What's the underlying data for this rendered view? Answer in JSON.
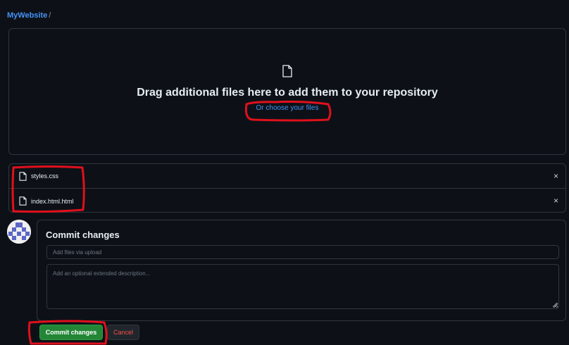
{
  "breadcrumb": {
    "repo": "MyWebsite",
    "separator": "/"
  },
  "dropzone": {
    "title": "Drag additional files here to add them to your repository",
    "prefix": "Or ",
    "link": "choose your files",
    "icon": "file-icon"
  },
  "files": [
    {
      "name": "styles.css",
      "icon": "file-icon",
      "remove": "×"
    },
    {
      "name": "index.html.html",
      "icon": "file-icon",
      "remove": "×"
    }
  ],
  "commit": {
    "title": "Commit changes",
    "summary_placeholder": "Add files via upload",
    "description_placeholder": "Add an optional extended description...",
    "commit_label": "Commit changes",
    "cancel_label": "Cancel"
  },
  "colors": {
    "background": "#0d1117",
    "link": "#4493f8",
    "commit_button": "#238636",
    "cancel_text": "#f85149",
    "annotation": "#e0101c"
  }
}
